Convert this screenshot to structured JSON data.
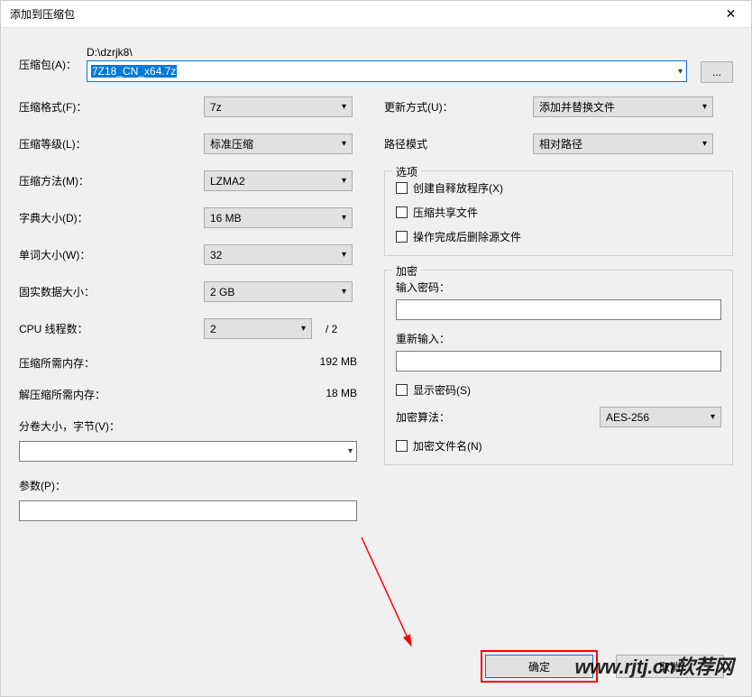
{
  "titlebar": {
    "title": "添加到压缩包"
  },
  "archive": {
    "label": "压缩包(A)：",
    "path": "D:\\dzrjk8\\",
    "filename": "7Z18_CN_x64.7z",
    "browse": "..."
  },
  "left": {
    "format_label": "压缩格式(F)：",
    "format_value": "7z",
    "level_label": "压缩等级(L)：",
    "level_value": "标准压缩",
    "method_label": "压缩方法(M)：",
    "method_value": "LZMA2",
    "dict_label": "字典大小(D)：",
    "dict_value": "16 MB",
    "word_label": "单词大小(W)：",
    "word_value": "32",
    "solid_label": "固实数据大小：",
    "solid_value": "2 GB",
    "cpu_label": "CPU 线程数：",
    "cpu_value": "2",
    "cpu_total": "/ 2",
    "mem_compress_label": "压缩所需内存：",
    "mem_compress_value": "192 MB",
    "mem_decompress_label": "解压缩所需内存：",
    "mem_decompress_value": "18 MB",
    "volume_label": "分卷大小，字节(V)：",
    "params_label": "参数(P)："
  },
  "right": {
    "update_label": "更新方式(U)：",
    "update_value": "添加并替换文件",
    "pathmode_label": "路径模式",
    "pathmode_value": "相对路径",
    "options_legend": "选项",
    "opt_sfx": "创建自释放程序(X)",
    "opt_shared": "压缩共享文件",
    "opt_delete": "操作完成后删除源文件",
    "enc_legend": "加密",
    "enc_pwd_label": "输入密码：",
    "enc_repwd_label": "重新输入：",
    "enc_show": "显示密码(S)",
    "enc_algo_label": "加密算法：",
    "enc_algo_value": "AES-256",
    "enc_filenames": "加密文件名(N)"
  },
  "buttons": {
    "ok": "确定",
    "cancel": "取消"
  },
  "watermark": "www.rjtj.cn软荐网"
}
